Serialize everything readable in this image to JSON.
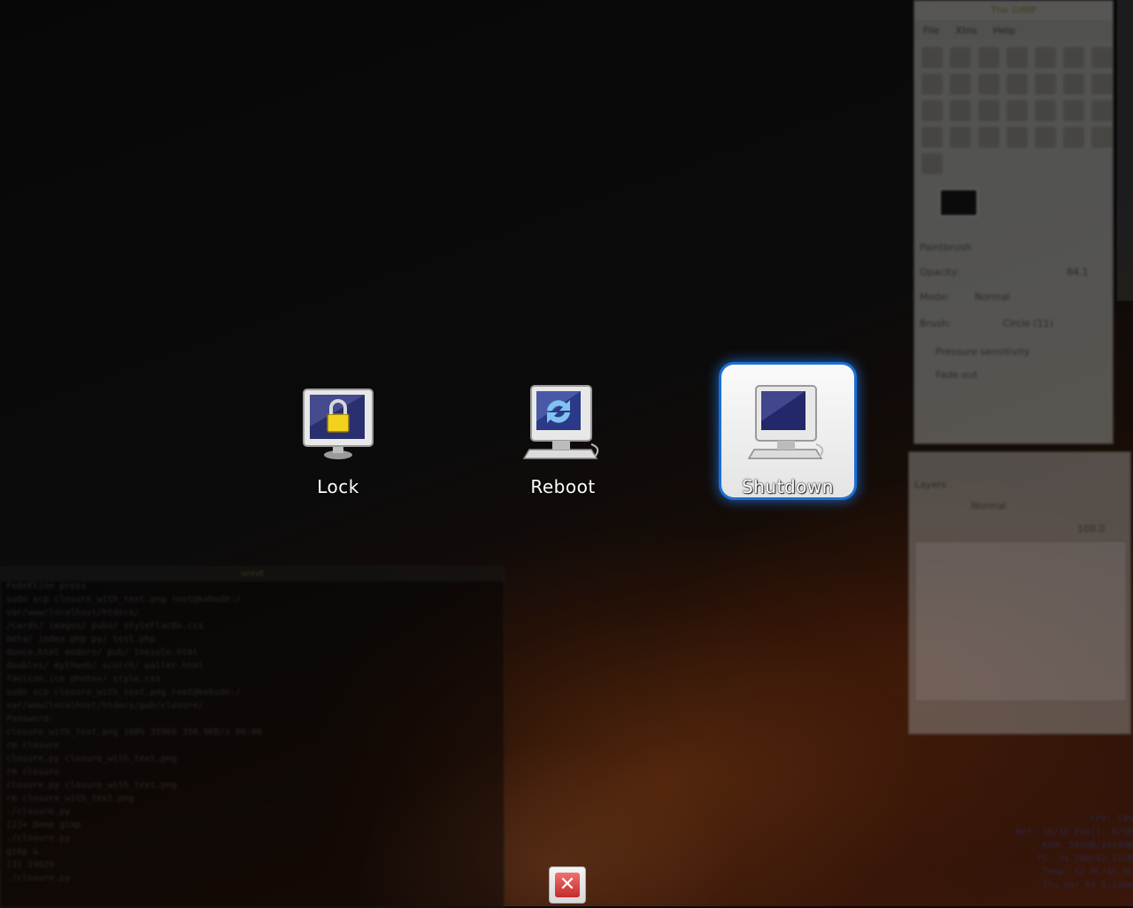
{
  "logout_dialog": {
    "actions": [
      {
        "label": "Lock",
        "icon": "monitor-lock-icon",
        "selected": false
      },
      {
        "label": "Reboot",
        "icon": "computer-reboot-icon",
        "selected": false
      },
      {
        "label": "Shutdown",
        "icon": "computer-shutdown-icon",
        "selected": true
      }
    ],
    "cancel_icon": "close-icon",
    "accent_color": "#1c6fd6",
    "cancel_color": "#d23a3a"
  },
  "background": {
    "gimp_toolbox": {
      "menus": [
        "File",
        "Xtns",
        "Help"
      ],
      "panel_title": "Paintbrush",
      "options": [
        "Opacity:",
        "Mode:",
        "Brush:",
        "Pressure sensitivity",
        "Fade out"
      ],
      "mode_value": "Normal",
      "brush_value": "Circle (11)",
      "opacity_value": "84.1"
    },
    "gimp_layers": {
      "title": "Layers",
      "mode_value": "Normal",
      "opacity_value": "100.0"
    },
    "terminal": {
      "lines": [
        "FedeKtion press",
        "sudo scp closure_with_text.png root@kobude:/",
        "var/www/localhost/htdocs/",
        "/Cards/           images/        pubs/           styleFlacBo.css",
        "beta/             index.php      py/             test.php",
        "dunce.html        modern/        pub/            thesale.html",
        "doubles/          mythweb/       scotch/         waller.html",
        "favicon.ico       photos/        style.css",
        "sudo scp closure_with_text.png root@kobude:/",
        "var/www/localhost/htdocs/pub/closure/",
        "Password:",
        "closure_with_text.png                   100%  35969  350.0KB/s   00:00",
        "rm closure",
        "closure.py             closure_with_text.png",
        "rm closure",
        "closure.py             closure_with_text.png",
        "rm closure_with_text.png",
        "./closure.py",
        "[2]+  Done                    gimp",
        "./closure.py",
        "gimp &",
        "[3] 19829",
        "./closure.py"
      ]
    },
    "system_monitor": [
      "CPU: 19%",
      "Net: 16/16  Email: 0/98",
      "RAM: 560MB/2014MB",
      "FS: 34.2GB/42.11GB",
      "Temp: 52.0C/45.0C",
      "Thu Apr 05  8:10pm"
    ]
  }
}
